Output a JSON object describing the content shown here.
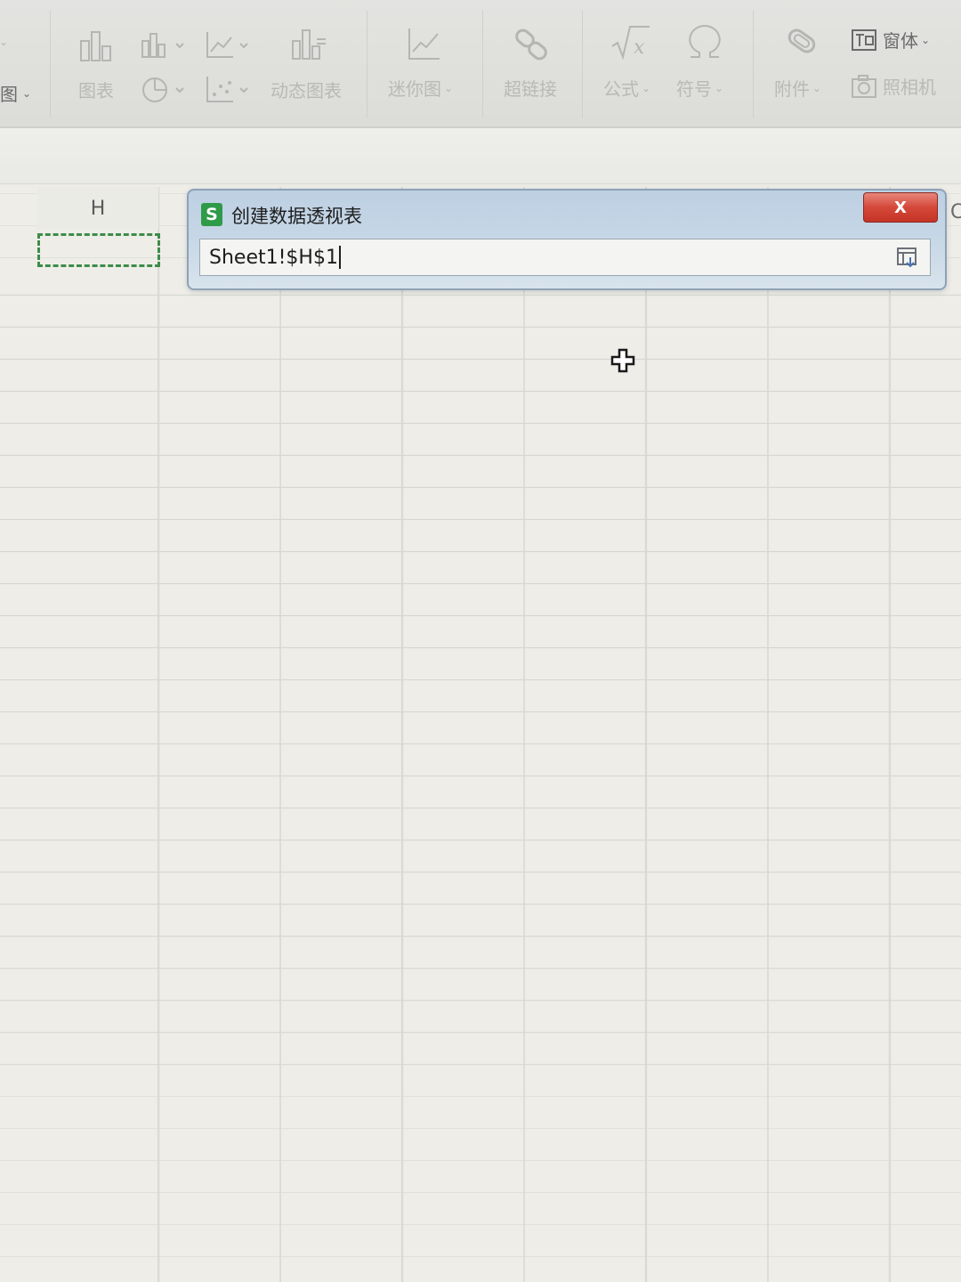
{
  "ribbon": {
    "left_cut_label": "图",
    "chart_label": "图表",
    "dynamic_chart_label": "动态图表",
    "sparkline_label": "迷你图",
    "hyperlink_label": "超链接",
    "formula_label": "公式",
    "symbol_label": "符号",
    "attachment_label": "附件",
    "window_body_label": "窗体",
    "camera_label": "照相机",
    "caret": "⌄"
  },
  "grid": {
    "column_header": "H",
    "right_edge_letter": "C"
  },
  "dialog": {
    "icon_letter": "S",
    "title": "创建数据透视表",
    "close_label": "X",
    "input_value": "Sheet1!$H$1"
  },
  "colors": {
    "selection_border": "#3d8c4a",
    "dialog_icon": "#2f9a48",
    "close_button": "#d4483a",
    "dialog_title_bar": "#c5d6e6"
  }
}
